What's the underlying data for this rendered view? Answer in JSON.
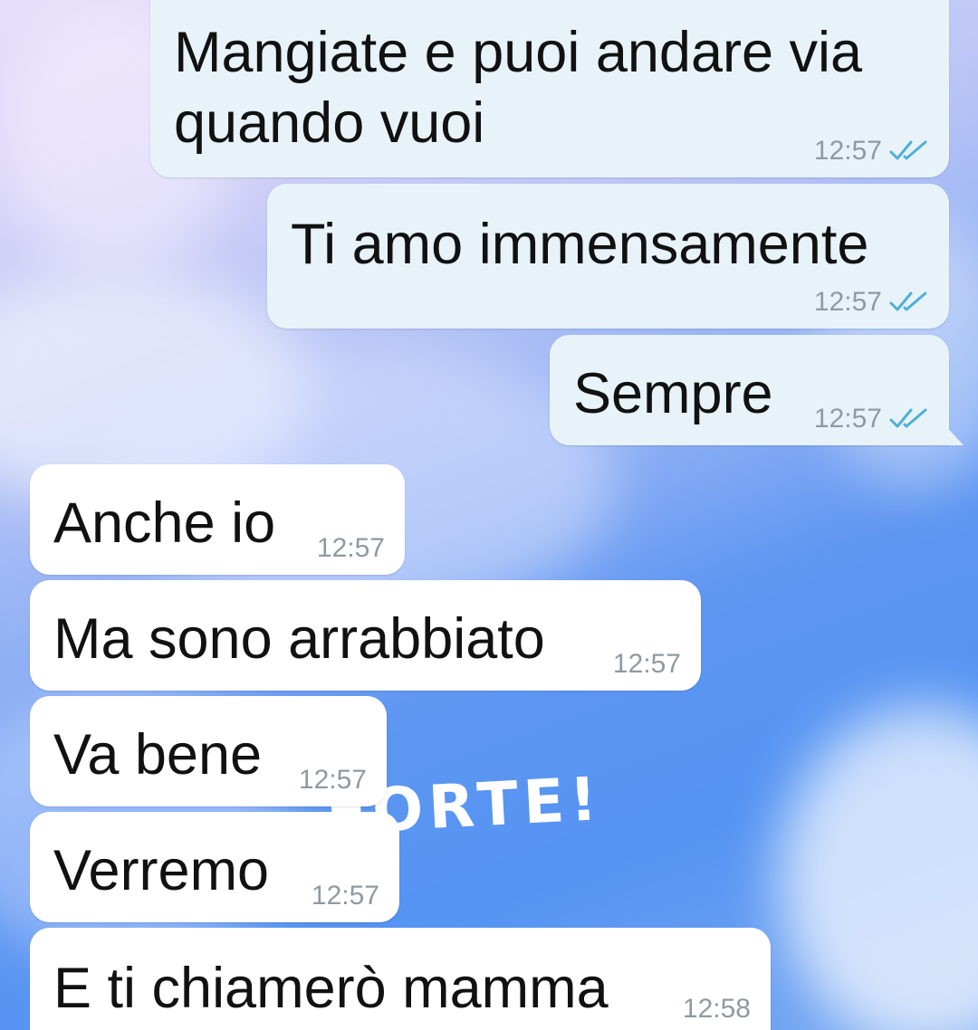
{
  "wallpaper": {
    "text": "FORTE!"
  },
  "messages": [
    {
      "text_lines": [
        "Mangiate e puoi andare via",
        "quando vuoi"
      ],
      "time": "12:57",
      "direction": "out",
      "status": "read-double-check-icon"
    },
    {
      "text": "Ti amo immensamente",
      "time": "12:57",
      "direction": "out",
      "status": "read-double-check-icon"
    },
    {
      "text": "Sempre",
      "time": "12:57",
      "direction": "out",
      "status": "read-double-check-icon"
    },
    {
      "text": "Anche io",
      "time": "12:57",
      "direction": "in"
    },
    {
      "text": "Ma sono arrabbiato",
      "time": "12:57",
      "direction": "in"
    },
    {
      "text": "Va bene",
      "time": "12:57",
      "direction": "in"
    },
    {
      "text": "Verremo",
      "time": "12:57",
      "direction": "in"
    },
    {
      "text": "E ti chiamerò mamma",
      "time": "12:58",
      "direction": "in"
    }
  ],
  "colors": {
    "outgoing_bubble": "#e8f3f9",
    "incoming_bubble": "#ffffff",
    "timestamp": "#8e9aa3",
    "read_check": "#4fb0d6"
  }
}
